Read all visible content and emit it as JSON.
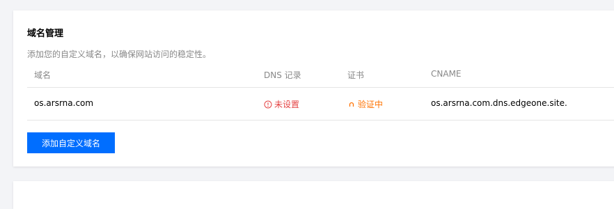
{
  "section": {
    "title": "域名管理",
    "description": "添加您的自定义域名，以确保网站访问的稳定性。"
  },
  "table": {
    "headers": [
      "域名",
      "DNS 记录",
      "证书",
      "CNAME"
    ],
    "rows": [
      {
        "domain": "os.arsrna.com",
        "dns_record": "未设置",
        "dns_icon": "alert-circle-icon",
        "certificate": "验证中",
        "certificate_icon": "loading-icon",
        "cname": "os.arsrna.com.dns.edgeone.site."
      }
    ]
  },
  "actions": {
    "add_domain_label": "添加自定义域名"
  },
  "colors": {
    "primary": "#006eff",
    "error": "#e54545",
    "warning": "#ff7200",
    "muted_text": "#888888"
  }
}
